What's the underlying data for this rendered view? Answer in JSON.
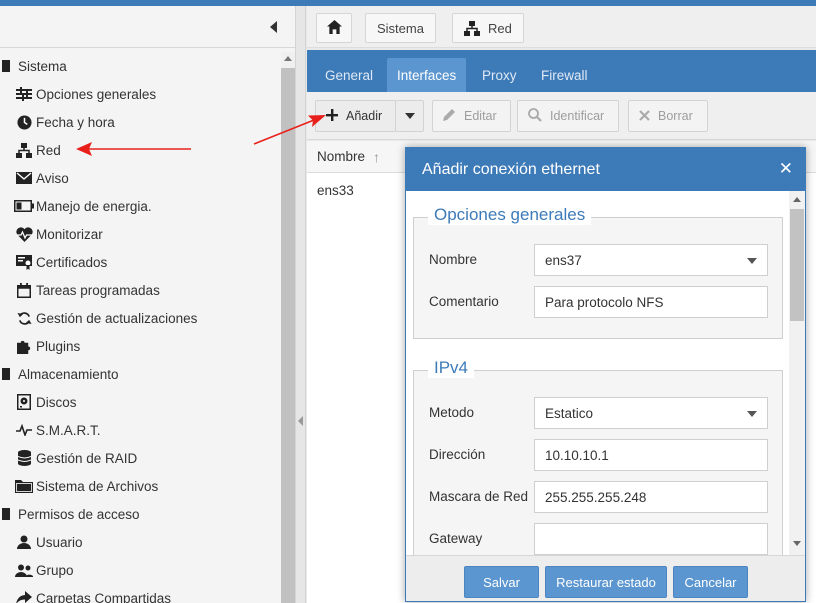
{
  "sidebar": {
    "items": [
      {
        "label": "Sistema",
        "icon": "system-icon",
        "kind": "group"
      },
      {
        "label": "Opciones generales",
        "icon": "sliders-icon",
        "kind": "child"
      },
      {
        "label": "Fecha y hora",
        "icon": "clock-icon",
        "kind": "child"
      },
      {
        "label": "Red",
        "icon": "network-icon",
        "kind": "child"
      },
      {
        "label": "Aviso",
        "icon": "envelope-icon",
        "kind": "child"
      },
      {
        "label": "Manejo de energia.",
        "icon": "battery-icon",
        "kind": "child"
      },
      {
        "label": "Monitorizar",
        "icon": "heartbeat-icon",
        "kind": "child"
      },
      {
        "label": "Certificados",
        "icon": "certificate-icon",
        "kind": "child"
      },
      {
        "label": "Tareas programadas",
        "icon": "calendar-icon",
        "kind": "child"
      },
      {
        "label": "Gestión de actualizaciones",
        "icon": "refresh-icon",
        "kind": "child"
      },
      {
        "label": "Plugins",
        "icon": "puzzle-icon",
        "kind": "child"
      },
      {
        "label": "Almacenamiento",
        "icon": "storage-icon",
        "kind": "group"
      },
      {
        "label": "Discos",
        "icon": "disk-icon",
        "kind": "child"
      },
      {
        "label": "S.M.A.R.T.",
        "icon": "pulse-icon",
        "kind": "child"
      },
      {
        "label": "Gestión de RAID",
        "icon": "database-icon",
        "kind": "child"
      },
      {
        "label": "Sistema de Archivos",
        "icon": "folder-icon",
        "kind": "child"
      },
      {
        "label": "Permisos de acceso",
        "icon": "permissions-icon",
        "kind": "group"
      },
      {
        "label": "Usuario",
        "icon": "user-icon",
        "kind": "child"
      },
      {
        "label": "Grupo",
        "icon": "group-icon",
        "kind": "child"
      },
      {
        "label": "Carpetas Compartidas",
        "icon": "share-icon",
        "kind": "child"
      }
    ]
  },
  "breadcrumb": {
    "home_icon": "home-icon",
    "items": [
      {
        "label": "Sistema"
      },
      {
        "label": "Red",
        "icon": "network-icon"
      }
    ]
  },
  "tabs": [
    {
      "label": "General",
      "active": false
    },
    {
      "label": "Interfaces",
      "active": true
    },
    {
      "label": "Proxy",
      "active": false
    },
    {
      "label": "Firewall",
      "active": false
    }
  ],
  "toolbar": {
    "add": "Añadir",
    "edit": "Editar",
    "identify": "Identificar",
    "delete": "Borrar"
  },
  "grid": {
    "column": "Nombre",
    "rows": [
      "ens33"
    ]
  },
  "modal": {
    "title": "Añadir conexión ethernet",
    "section_general": "Opciones generales",
    "name_label": "Nombre",
    "name_value": "ens37",
    "comment_label": "Comentario",
    "comment_value": "Para protocolo NFS",
    "section_ipv4": "IPv4",
    "method_label": "Metodo",
    "method_value": "Estatico",
    "address_label": "Dirección",
    "address_value": "10.10.10.1",
    "mask_label": "Mascara de Red",
    "mask_value": "255.255.255.248",
    "gateway_label": "Gateway",
    "gateway_value": "",
    "save": "Salvar",
    "reset": "Restaurar estado",
    "cancel": "Cancelar"
  },
  "colors": {
    "accent": "#3d7ab8",
    "tab_active": "#5b96d0",
    "annotation_arrow": "#e8201c"
  }
}
